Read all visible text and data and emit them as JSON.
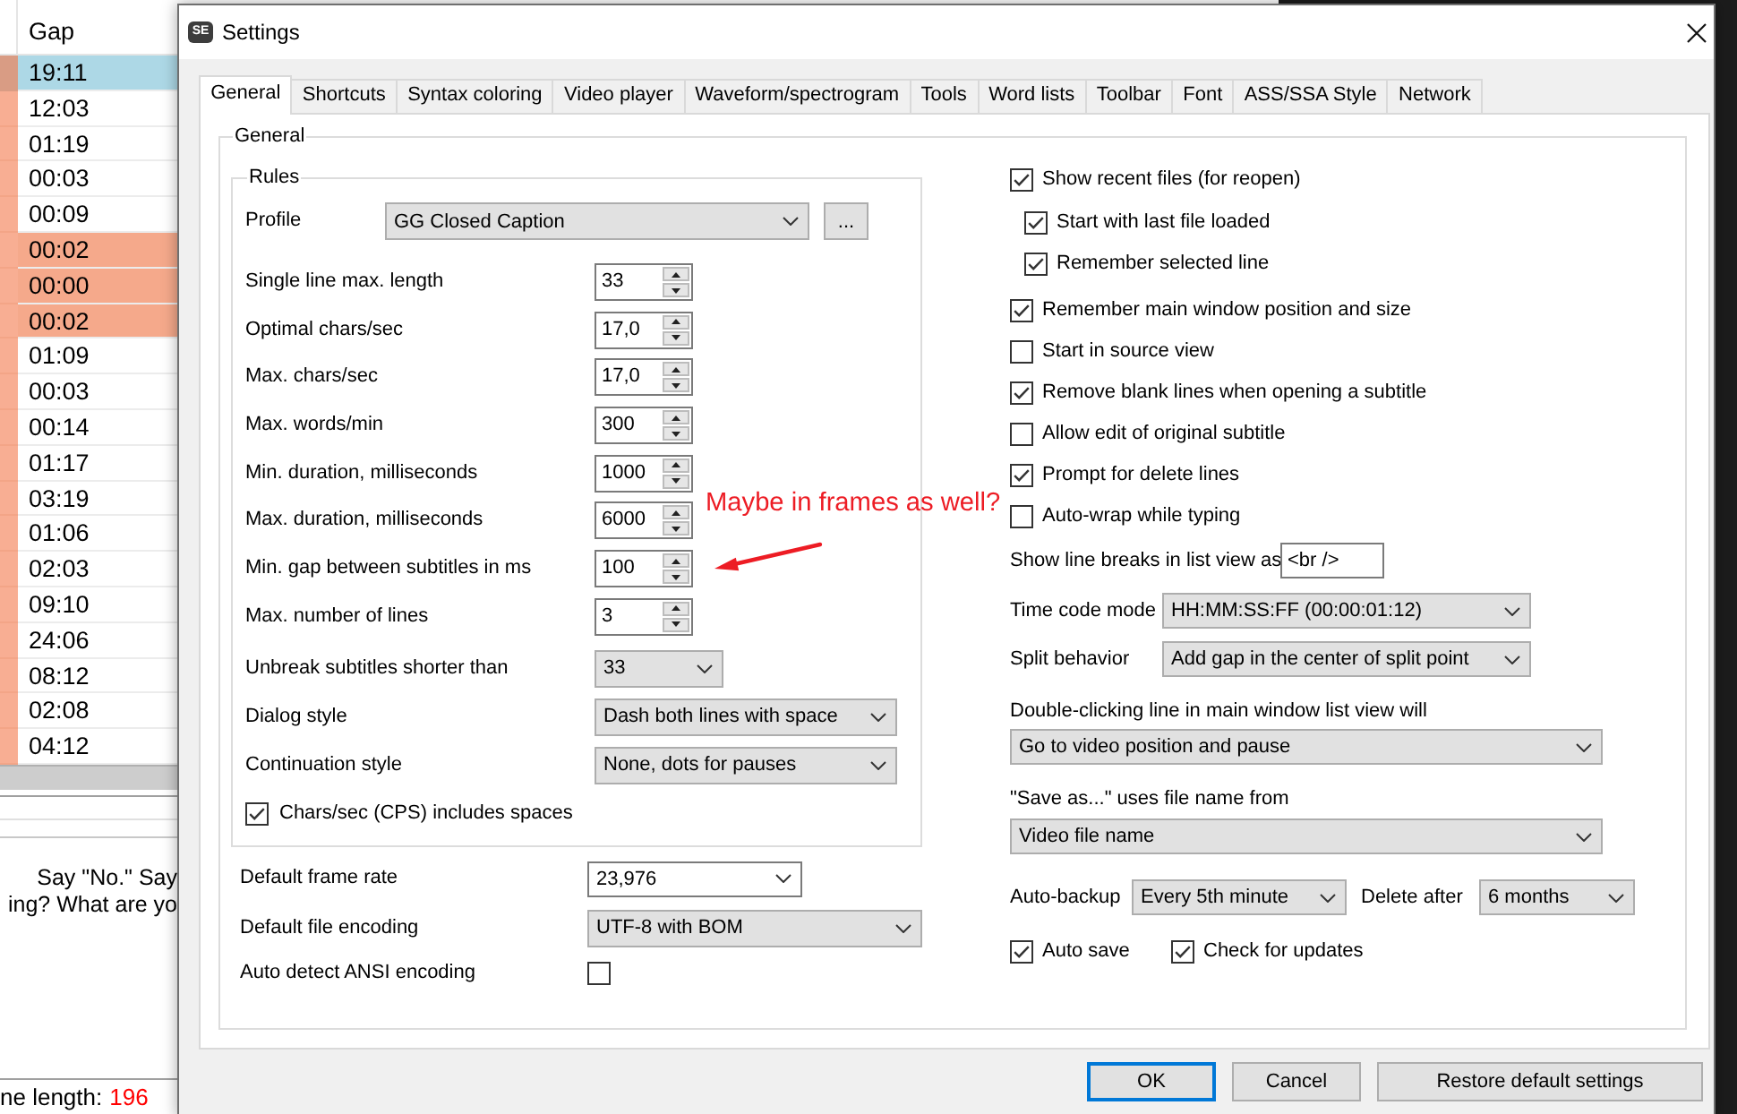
{
  "main_window": {
    "table": {
      "columns": [
        "Gap"
      ],
      "rows": [
        {
          "gap": "19:11",
          "selected": true,
          "flagged": false
        },
        {
          "gap": "12:03",
          "selected": false,
          "flagged": false
        },
        {
          "gap": "01:19",
          "selected": false,
          "flagged": false
        },
        {
          "gap": "00:03",
          "selected": false,
          "flagged": false
        },
        {
          "gap": "00:09",
          "selected": false,
          "flagged": false
        },
        {
          "gap": "00:02",
          "selected": false,
          "flagged": true
        },
        {
          "gap": "00:00",
          "selected": false,
          "flagged": true
        },
        {
          "gap": "00:02",
          "selected": false,
          "flagged": true
        },
        {
          "gap": "01:09",
          "selected": false,
          "flagged": false
        },
        {
          "gap": "00:03",
          "selected": false,
          "flagged": false
        },
        {
          "gap": "00:14",
          "selected": false,
          "flagged": false
        },
        {
          "gap": "01:17",
          "selected": false,
          "flagged": false
        },
        {
          "gap": "03:19",
          "selected": false,
          "flagged": false
        },
        {
          "gap": "01:06",
          "selected": false,
          "flagged": false
        },
        {
          "gap": "02:03",
          "selected": false,
          "flagged": false
        },
        {
          "gap": "09:10",
          "selected": false,
          "flagged": false
        },
        {
          "gap": "24:06",
          "selected": false,
          "flagged": false
        },
        {
          "gap": "08:12",
          "selected": false,
          "flagged": false
        },
        {
          "gap": "02:08",
          "selected": false,
          "flagged": false
        },
        {
          "gap": "04:12",
          "selected": false,
          "flagged": false
        }
      ]
    },
    "text_lines": [
      "Say \"No.\" Say",
      "ing? What are yo"
    ],
    "status": {
      "label": "ne length:",
      "value": "196"
    }
  },
  "dialog": {
    "icon_text": "SE",
    "title": "Settings",
    "tabs": [
      {
        "label": "General",
        "selected": true
      },
      {
        "label": "Shortcuts",
        "selected": false
      },
      {
        "label": "Syntax coloring",
        "selected": false
      },
      {
        "label": "Video player",
        "selected": false
      },
      {
        "label": "Waveform/spectrogram",
        "selected": false
      },
      {
        "label": "Tools",
        "selected": false
      },
      {
        "label": "Word lists",
        "selected": false
      },
      {
        "label": "Toolbar",
        "selected": false
      },
      {
        "label": "Font",
        "selected": false
      },
      {
        "label": "ASS/SSA Style",
        "selected": false
      },
      {
        "label": "Network",
        "selected": false
      }
    ],
    "page": {
      "title": "General",
      "rules": {
        "title": "Rules",
        "profile": {
          "label": "Profile",
          "value": "GG Closed Caption",
          "button": "..."
        },
        "fields": [
          {
            "kind": "spin",
            "label": "Single line max. length",
            "value": "33"
          },
          {
            "kind": "spin",
            "label": "Optimal chars/sec",
            "value": "17,0"
          },
          {
            "kind": "spin",
            "label": "Max. chars/sec",
            "value": "17,0"
          },
          {
            "kind": "spin",
            "label": "Max. words/min",
            "value": "300"
          },
          {
            "kind": "spin",
            "label": "Min. duration, milliseconds",
            "value": "1000"
          },
          {
            "kind": "spin",
            "label": "Max. duration, milliseconds",
            "value": "6000"
          },
          {
            "kind": "spin",
            "label": "Min. gap between subtitles in ms",
            "value": "100"
          },
          {
            "kind": "spin",
            "label": "Max. number of lines",
            "value": "3"
          },
          {
            "kind": "number_combo",
            "label": "Unbreak subtitles shorter than",
            "value": "33"
          },
          {
            "kind": "combo",
            "label": "Dialog style",
            "value": "Dash both lines with space"
          },
          {
            "kind": "combo",
            "label": "Continuation style",
            "value": "None, dots for pauses"
          }
        ],
        "cps_option": {
          "label": "Chars/sec (CPS) includes spaces",
          "checked": true
        }
      },
      "file_settings": [
        {
          "kind": "editable_combo",
          "label": "Default frame rate",
          "value": "23,976"
        },
        {
          "kind": "combo",
          "label": "Default file encoding",
          "value": "UTF-8 with BOM"
        },
        {
          "kind": "checkbox",
          "label": "Auto detect ANSI encoding",
          "checked": false
        }
      ],
      "options": [
        {
          "label": "Show recent files (for reopen)",
          "checked": true,
          "children": [
            {
              "label": "Start with last file loaded",
              "checked": true
            },
            {
              "label": "Remember selected line",
              "checked": true
            }
          ]
        },
        {
          "label": "Remember main window position and size",
          "checked": true
        },
        {
          "label": "Start in source view",
          "checked": false
        },
        {
          "label": "Remove blank lines when opening a subtitle",
          "checked": true
        },
        {
          "label": "Allow edit of original subtitle",
          "checked": false
        },
        {
          "label": "Prompt for delete lines",
          "checked": true
        },
        {
          "label": "Auto-wrap while typing",
          "checked": false
        }
      ],
      "line_breaks": {
        "label": "Show line breaks in list view as",
        "value": "<br />"
      },
      "modes": [
        {
          "label": "Time code mode",
          "value": "HH:MM:SS:FF (00:00:01:12)"
        },
        {
          "label": "Split behavior",
          "value": "Add gap in the center of split point"
        }
      ],
      "wide_selects": [
        {
          "label": "Double-clicking line in main window list view will",
          "value": "Go to video position and pause"
        },
        {
          "label": "\"Save as...\" uses file name from",
          "value": "Video file name"
        }
      ],
      "auto_backup": {
        "label": "Auto-backup",
        "value": "Every 5th minute",
        "delete_label": "Delete after",
        "delete_value": "6 months"
      },
      "bottom_checks": [
        {
          "label": "Auto save",
          "checked": true
        },
        {
          "label": "Check for updates",
          "checked": true
        }
      ]
    },
    "buttons": [
      {
        "label": "OK",
        "default": true
      },
      {
        "label": "Cancel",
        "default": false
      },
      {
        "label": "Restore default settings",
        "default": false
      }
    ]
  },
  "annotation": {
    "text": "Maybe in frames as well?"
  }
}
